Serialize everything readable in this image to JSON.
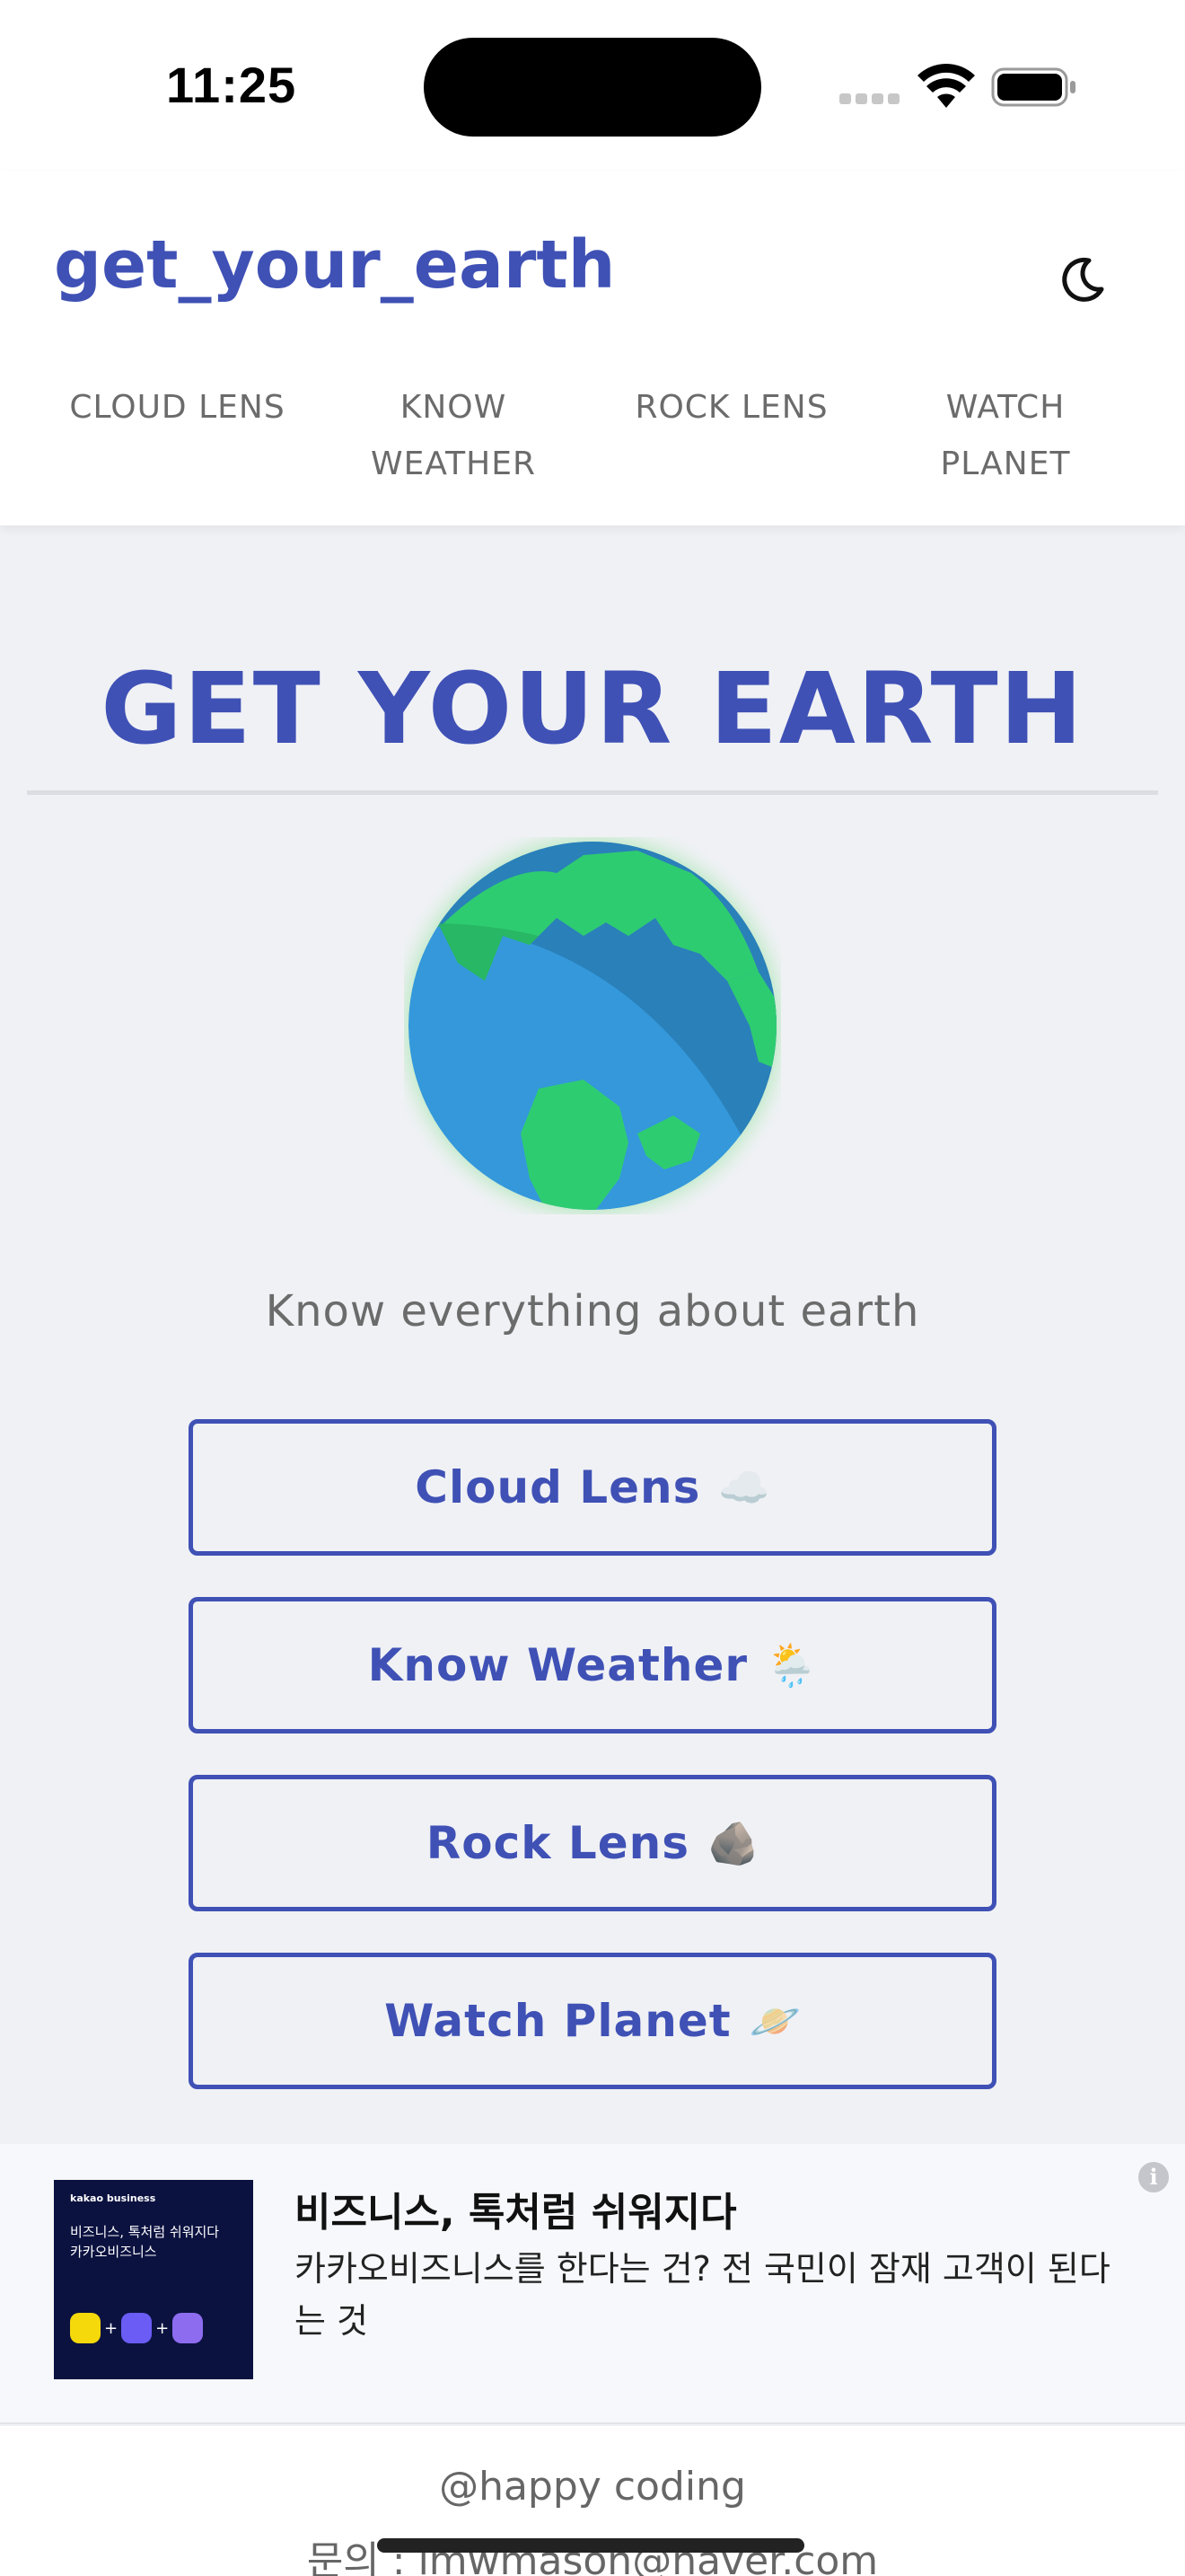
{
  "status_bar": {
    "time": "11:25"
  },
  "header": {
    "brand": "get_your_earth",
    "theme_toggle_icon": "moon-icon",
    "nav": [
      {
        "line1": "CLOUD LENS",
        "line2": ""
      },
      {
        "line1": "KNOW",
        "line2": "WEATHER"
      },
      {
        "line1": "ROCK LENS",
        "line2": ""
      },
      {
        "line1": "WATCH",
        "line2": "PLANET"
      }
    ]
  },
  "main": {
    "title": "GET YOUR EARTH",
    "earth_icon": "earth-globe-icon",
    "tagline": "Know everything about earth",
    "buttons": [
      {
        "label": "Cloud Lens",
        "emoji": "☁️"
      },
      {
        "label": "Know Weather",
        "emoji": "🌦️"
      },
      {
        "label": "Rock Lens",
        "emoji": "🪨"
      },
      {
        "label": "Watch Planet",
        "emoji": "🪐"
      }
    ]
  },
  "ad": {
    "thumb_brand": "kakao business",
    "thumb_line1": "비즈니스, 톡처럼 쉬워지다",
    "thumb_line2": "카카오비즈니스",
    "title": "비즈니스, 톡처럼 쉬워지다",
    "description": "카카오비즈니스를 한다는 건? 전 국민이 잠재 고객이 된다는 것",
    "info_icon": "info-icon"
  },
  "footer": {
    "credit": "@happy coding",
    "contact": "문의 : lmwmason@naver.com"
  },
  "colors": {
    "accent": "#3f51b5",
    "background": "#f0f1f5",
    "muted_text": "#6b6b6b"
  }
}
